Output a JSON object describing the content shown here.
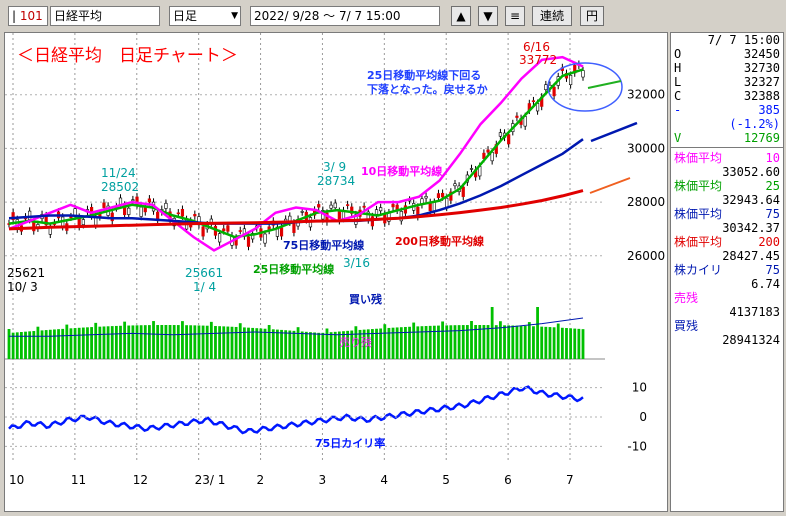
{
  "toolbar": {
    "code": "101",
    "name": "日経平均",
    "period": "日足",
    "range": "2022/ 9/28 ～  7/ 7 15:00",
    "up_label": "▲",
    "down_label": "▼",
    "menu_label": "≡",
    "continuous_label": "連続",
    "yen_label": "円"
  },
  "chart_data": {
    "type": "line",
    "title": "＜日経平均　日足チャート＞",
    "x_ticks": [
      "10",
      "11",
      "12",
      "23/ 1",
      "2",
      "3",
      "4",
      "5",
      "6",
      "7"
    ],
    "price_ticks": [
      "32000",
      "30000",
      "28000",
      "26000"
    ],
    "ylim": [
      24800,
      34000
    ],
    "kairi_ticks": [
      "10",
      "0",
      "-10"
    ],
    "kairi_ylim": [
      -15,
      15
    ],
    "series": [
      {
        "name": "25日移動平均線",
        "color": "#00b000",
        "values": [
          27200,
          27300,
          27200,
          27350,
          27500,
          27700,
          27900,
          27800,
          27500,
          27300,
          27000,
          26700,
          26800,
          27000,
          27300,
          27600,
          27700,
          27600,
          27500,
          27700,
          27900,
          28050,
          28500,
          29400,
          30300,
          31100,
          31900,
          32700,
          32943
        ]
      },
      {
        "name": "10日移動平均線",
        "color": "#ff00ff",
        "values": [
          27000,
          27300,
          27600,
          27900,
          27600,
          27800,
          28000,
          27900,
          27300,
          26700,
          26200,
          26600,
          27000,
          27600,
          27800,
          27700,
          27300,
          27500,
          28000,
          28000,
          28200,
          28800,
          29800,
          30900,
          31700,
          32600,
          33300,
          33400,
          33052
        ]
      },
      {
        "name": "75日移動平均線",
        "color": "#0018b0",
        "values": [
          27400,
          27450,
          27500,
          27500,
          27450,
          27400,
          27400,
          27350,
          27300,
          27250,
          27200,
          27200,
          27200,
          27200,
          27250,
          27300,
          27300,
          27300,
          27350,
          27400,
          27500,
          27700,
          27950,
          28250,
          28600,
          29000,
          29400,
          29800,
          30342
        ]
      },
      {
        "name": "200日移動平均線",
        "color": "#e00000",
        "values": [
          27000,
          27030,
          27060,
          27080,
          27100,
          27120,
          27140,
          27160,
          27180,
          27200,
          27210,
          27220,
          27230,
          27250,
          27270,
          27290,
          27300,
          27320,
          27360,
          27400,
          27460,
          27530,
          27610,
          27700,
          27800,
          27920,
          28060,
          28230,
          28427
        ]
      }
    ],
    "kairi": {
      "name": "75日カイリ率",
      "color": "#0018ff",
      "values": [
        -4,
        -2,
        -3,
        -1,
        0,
        -2,
        -3,
        -4,
        -3,
        -2,
        -1,
        -3,
        -5,
        -4,
        -3,
        -2,
        -1,
        0,
        -1,
        0,
        1,
        2,
        3,
        4,
        6,
        8,
        10,
        8,
        7,
        6
      ]
    },
    "buy_balance": {
      "name": "買い残",
      "color": "#0018b0",
      "values": [
        20,
        20,
        21,
        22,
        21,
        22,
        23,
        22,
        21,
        22,
        23,
        24,
        26,
        29,
        33
      ]
    },
    "volume_color": "#00c000",
    "annotations": [
      {
        "text": "25621",
        "price": 25621
      },
      {
        "text": "10/ 3"
      },
      {
        "text": "11/24"
      },
      {
        "text": "28502"
      },
      {
        "text": "3/ 9"
      },
      {
        "text": "28734"
      },
      {
        "text": "25661"
      },
      {
        "text": "1/ 4"
      },
      {
        "text": "3/16"
      },
      {
        "text": "6/16"
      },
      {
        "text": "33772"
      },
      {
        "text": "25日移動平均線下回る"
      },
      {
        "text": "下落となった。戻せるか"
      },
      {
        "text": "10日移動平均線"
      },
      {
        "text": "75日移動平均線"
      },
      {
        "text": "200日移動平均線"
      },
      {
        "text": "25日移動平均線"
      },
      {
        "text": "買い残"
      },
      {
        "text": "売り残"
      },
      {
        "text": "75日カイリ率"
      }
    ]
  },
  "panel": {
    "datetime": "7/ 7 15:00",
    "ohlc": [
      {
        "label": "O",
        "value": "32450"
      },
      {
        "label": "H",
        "value": "32730"
      },
      {
        "label": "L",
        "value": "32327"
      },
      {
        "label": "C",
        "value": "32388"
      },
      {
        "label": "-",
        "value": "385"
      }
    ],
    "change_pct": "(-1.2%)",
    "volume_label": "V",
    "volume_value": "12769",
    "ma": [
      {
        "label": "株価平均",
        "period": "10",
        "value": "33052.60",
        "color": "#ff00ff"
      },
      {
        "label": "株価平均",
        "period": "25",
        "value": "32943.64",
        "color": "#00a000"
      },
      {
        "label": "株価平均",
        "period": "75",
        "value": "30342.37",
        "color": "#0018b0"
      },
      {
        "label": "株価平均",
        "period": "200",
        "value": "28427.45",
        "color": "#e00000"
      }
    ],
    "kairi_label": "株カイリ",
    "kairi_period": "75",
    "kairi_value": "6.74",
    "sell_label": "売残",
    "sell_value": "4137183",
    "buy_label": "買残",
    "buy_value": "28941324"
  }
}
